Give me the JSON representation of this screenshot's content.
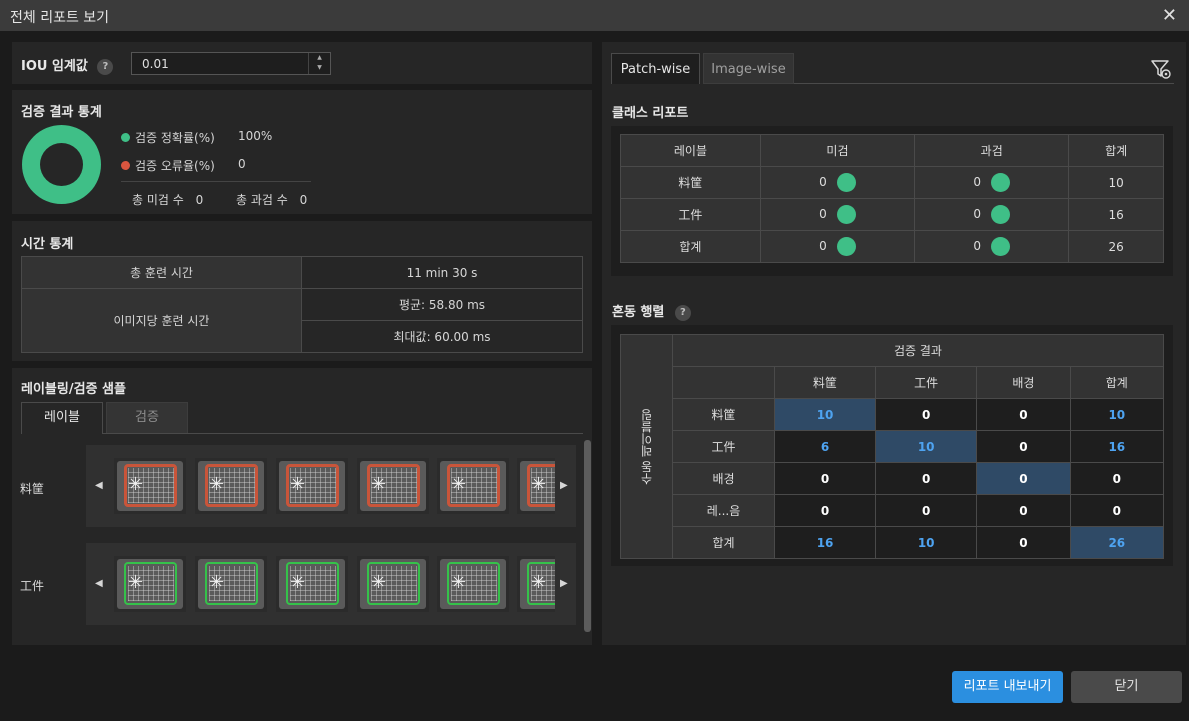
{
  "window": {
    "title": "전체 리포트 보기",
    "close_icon": "close-icon"
  },
  "iou": {
    "label": "IOU 임계값",
    "help": "?",
    "value": "0.01"
  },
  "val_stats": {
    "title": "검증 결과 통계",
    "accuracy_label": "검증 정확률(%)",
    "accuracy_value": "100%",
    "accuracy_color": "#3fbf87",
    "error_label": "검증 오류율(%)",
    "error_value": "0",
    "error_color": "#d9553f",
    "miss_label": "총 미검 수",
    "miss_value": "0",
    "over_label": "총 과검 수",
    "over_value": "0"
  },
  "time_stats": {
    "title": "시간 통계",
    "total_label": "총 훈련 시간",
    "total_value": "11 min 30 s",
    "per_image_label": "이미지당 훈련 시간",
    "avg": "평균: 58.80 ms",
    "max": "최대값: 60.00 ms"
  },
  "samples": {
    "title": "레이블링/검증 샘플",
    "tabs": [
      {
        "label": "레이블"
      },
      {
        "label": "검증"
      }
    ],
    "rows": [
      {
        "label": "料筐"
      },
      {
        "label": "工件"
      }
    ]
  },
  "right_tabs": [
    {
      "label": "Patch-wise"
    },
    {
      "label": "Image-wise"
    }
  ],
  "class_report": {
    "title": "클래스 리포트",
    "headers": [
      "레이블",
      "미검",
      "과검",
      "합계"
    ],
    "rows": [
      {
        "label": "料筐",
        "miss": "0",
        "over": "0",
        "total": "10"
      },
      {
        "label": "工件",
        "miss": "0",
        "over": "0",
        "total": "16"
      },
      {
        "label": "합계",
        "miss": "0",
        "over": "0",
        "total": "26"
      }
    ]
  },
  "confusion": {
    "title": "혼동 행렬",
    "help": "?",
    "top_header": "검증 결과",
    "side_header": "수동 레이블링",
    "col_headers": [
      "料筐",
      "工件",
      "배경",
      "합계"
    ],
    "rows": [
      {
        "label": "料筐",
        "values": [
          "10",
          "0",
          "0",
          "10"
        ]
      },
      {
        "label": "工件",
        "values": [
          "6",
          "10",
          "0",
          "16"
        ]
      },
      {
        "label": "배경",
        "values": [
          "0",
          "0",
          "0",
          "0"
        ]
      },
      {
        "label": "레...음",
        "values": [
          "0",
          "0",
          "0",
          "0"
        ]
      },
      {
        "label": "합계",
        "values": [
          "16",
          "10",
          "0",
          "26"
        ]
      }
    ]
  },
  "buttons": {
    "export": "리포트 내보내기",
    "close": "닫기"
  }
}
